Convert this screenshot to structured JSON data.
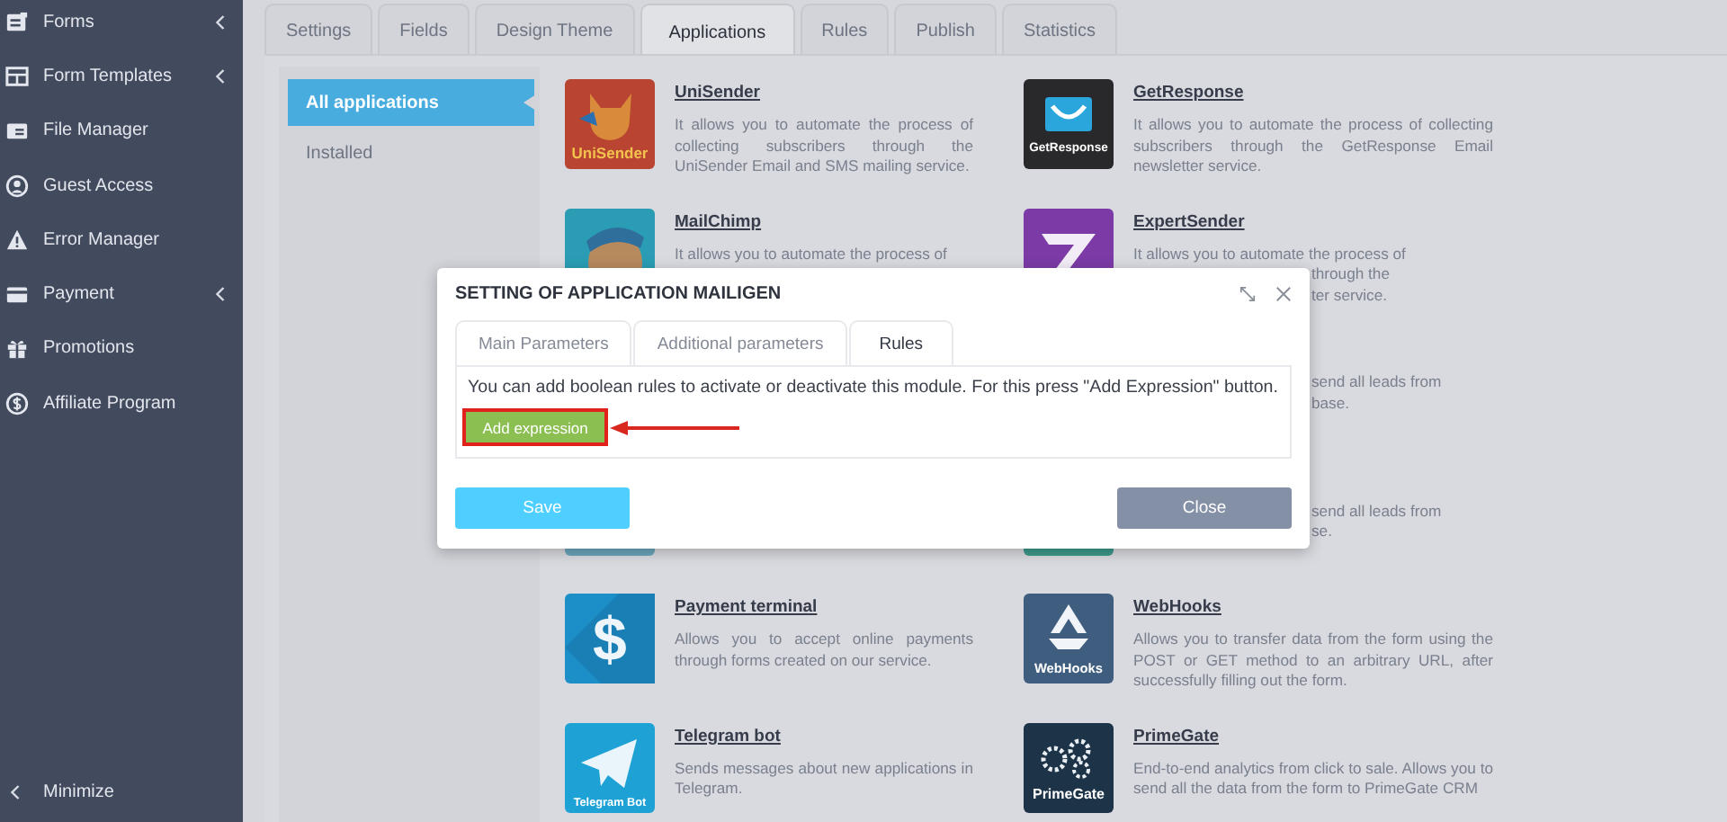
{
  "sidebar": {
    "items": [
      {
        "label": "Forms",
        "kind": "forms",
        "has_submenu": true
      },
      {
        "label": "Form Templates",
        "kind": "templates",
        "has_submenu": true
      },
      {
        "label": "File Manager",
        "kind": "files",
        "has_submenu": false
      },
      {
        "label": "Guest Access",
        "kind": "guest",
        "has_submenu": false
      },
      {
        "label": "Error Manager",
        "kind": "warning",
        "has_submenu": false
      },
      {
        "label": "Payment",
        "kind": "card",
        "has_submenu": true
      },
      {
        "label": "Promotions",
        "kind": "gift",
        "has_submenu": false
      },
      {
        "label": "Affiliate Program",
        "kind": "dollar",
        "has_submenu": false
      }
    ],
    "minimize": "Minimize"
  },
  "tabs": [
    {
      "label": "Settings",
      "selected": false
    },
    {
      "label": "Fields",
      "selected": false
    },
    {
      "label": "Design Theme",
      "selected": false
    },
    {
      "label": "Applications",
      "selected": true
    },
    {
      "label": "Rules",
      "selected": false
    },
    {
      "label": "Publish",
      "selected": false
    },
    {
      "label": "Statistics",
      "selected": false
    }
  ],
  "subnav": [
    {
      "label": "All applications",
      "selected": true
    },
    {
      "label": "Installed",
      "selected": false
    }
  ],
  "apps": [
    {
      "kind": "mascot",
      "logo_text": "UniSender",
      "title": "UniSender",
      "description": "It allows you to automate the process of collecting subscribers through the UniSender Email and SMS mailing service."
    },
    {
      "kind": "smile",
      "logo_text": "GetResponse",
      "title": "GetResponse",
      "description": "It allows you to automate the process of collecting subscribers through the GetResponse Email newsletter service."
    },
    {
      "kind": "chimp",
      "title": "MailChimp",
      "description": "It allows you to automate the process of"
    },
    {
      "kind": "zigzag",
      "title": "ExpertSender",
      "description": "It allows you to automate the process of",
      "fragments": [
        "through the",
        "ter service."
      ]
    },
    {
      "kind": "none"
    },
    {
      "kind": "none",
      "fragments": [
        "send all leads from",
        "base."
      ]
    },
    {
      "kind": "bluetile"
    },
    {
      "kind": "greentile",
      "fragments": [
        "send all leads from",
        "se."
      ]
    },
    {
      "kind": "dollar",
      "logo_text": "$",
      "title": "Payment terminal",
      "description": "Allows you to accept online payments through forms created on our service."
    },
    {
      "kind": "hooks",
      "logo_text": "WebHooks",
      "title": "WebHooks",
      "description": "Allows you to transfer data from the form using the POST or GET method to an arbitrary URL, after successfully filling out the form."
    },
    {
      "kind": "plane",
      "logo_text": "Telegram Bot",
      "title": "Telegram bot",
      "description": "Sends messages about new applications in Telegram."
    },
    {
      "kind": "gears",
      "logo_text": "PrimeGate",
      "title": "PrimeGate",
      "description": "End-to-end analytics from click to sale. Allows you to send all the data from the form to PrimeGate CRM"
    }
  ],
  "modal": {
    "title": "SETTING OF APPLICATION MAILIGEN",
    "tabs": [
      {
        "label": "Main Parameters",
        "selected": false
      },
      {
        "label": "Additional parameters",
        "selected": false
      },
      {
        "label": "Rules",
        "selected": true
      }
    ],
    "message": "You can add boolean rules to activate or deactivate this module. For this press \"Add Expression\" button.",
    "add_button": "Add expression",
    "highlighted": true,
    "save": "Save",
    "close": "Close"
  }
}
